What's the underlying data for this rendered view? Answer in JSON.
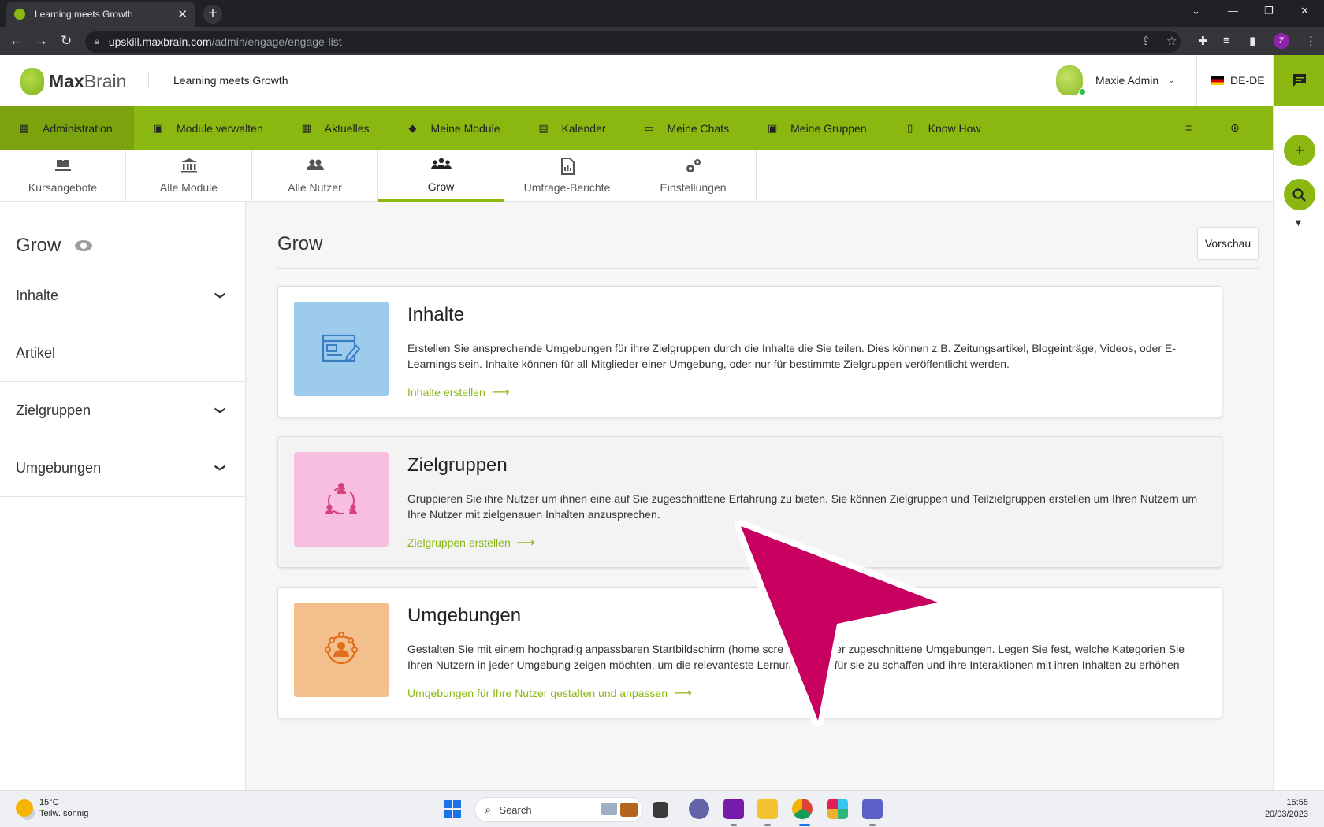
{
  "browser": {
    "tab_title": "Learning meets Growth",
    "url_host": "upskill.maxbrain.com",
    "url_path": "/admin/engage/engage-list",
    "profile_initial": "Z"
  },
  "header": {
    "logo_bold": "Max",
    "logo_light": "Brain",
    "tagline": "Learning meets Growth",
    "user_name": "Maxie Admin",
    "language": "DE-DE"
  },
  "main_nav": [
    {
      "label": "Administration",
      "icon": "admin-icon"
    },
    {
      "label": "Module verwalten",
      "icon": "module-manage-icon"
    },
    {
      "label": "Aktuelles",
      "icon": "news-icon"
    },
    {
      "label": "Meine Module",
      "icon": "graduation-cap-icon"
    },
    {
      "label": "Kalender",
      "icon": "calendar-icon"
    },
    {
      "label": "Meine Chats",
      "icon": "monitor-icon"
    },
    {
      "label": "Meine Gruppen",
      "icon": "groups-icon"
    },
    {
      "label": "Know How",
      "icon": "book-icon"
    }
  ],
  "sub_tabs": [
    {
      "label": "Kursangebote",
      "icon": "hand-book-icon"
    },
    {
      "label": "Alle Module",
      "icon": "institution-icon"
    },
    {
      "label": "Alle Nutzer",
      "icon": "users-icon"
    },
    {
      "label": "Grow",
      "icon": "group-icon"
    },
    {
      "label": "Umfrage-Berichte",
      "icon": "report-icon"
    },
    {
      "label": "Einstellungen",
      "icon": "gears-icon"
    }
  ],
  "sidebar": {
    "title": "Grow",
    "items": [
      {
        "label": "Inhalte",
        "expandable": true
      },
      {
        "label": "Artikel",
        "expandable": false
      },
      {
        "label": "Zielgruppen",
        "expandable": true
      },
      {
        "label": "Umgebungen",
        "expandable": true
      }
    ]
  },
  "main": {
    "title": "Grow",
    "preview_label": "Vorschau",
    "cards": [
      {
        "title": "Inhalte",
        "description": "Erstellen Sie ansprechende Umgebungen für ihre Zielgruppen durch die Inhalte die Sie teilen. Dies können z.B. Zeitungsartikel, Blogeinträge, Videos, oder E-Learnings sein. Inhalte können für all Mitglieder einer Umgebung, oder nur für bestimmte Zielgruppen veröffentlicht werden.",
        "link": "Inhalte erstellen",
        "tile_color": "#9dcbec",
        "icon_color": "#3a7ec1"
      },
      {
        "title": "Zielgruppen",
        "description": "Gruppieren Sie ihre Nutzer um ihnen eine auf Sie zugeschnittene Erfahrung zu bieten. Sie können Zielgruppen und Teilzielgruppen erstellen um Ihren Nutzern um Ihre Nutzer mit zielgenauen Inhalten anzusprechen.",
        "link": "Zielgruppen erstellen",
        "tile_color": "#f7bedf",
        "icon_color": "#d6427e"
      },
      {
        "title": "Umgebungen",
        "description": "Gestalten Sie mit einem hochgradig anpassbaren Startbildschirm (home screen) benutzer zugeschnittene Umgebungen. Legen Sie fest, welche Kategorien Sie Ihren Nutzern in jeder Umgebung zeigen möchten, um die relevanteste Lernumgebung für sie zu schaffen und ihre Interaktionen mit ihren Inhalten zu erhöhen",
        "link": "Umgebungen für Ihre Nutzer gestalten und anpassen",
        "tile_color": "#f3bf8d",
        "icon_color": "#e06f1c"
      }
    ]
  },
  "taskbar": {
    "temperature": "15°C",
    "weather": "Teilw. sonnig",
    "search_placeholder": "Search",
    "time": "15:55",
    "date": "20/03/2023"
  },
  "colors": {
    "accent": "#8ab811",
    "pointer": "#c8005f"
  }
}
